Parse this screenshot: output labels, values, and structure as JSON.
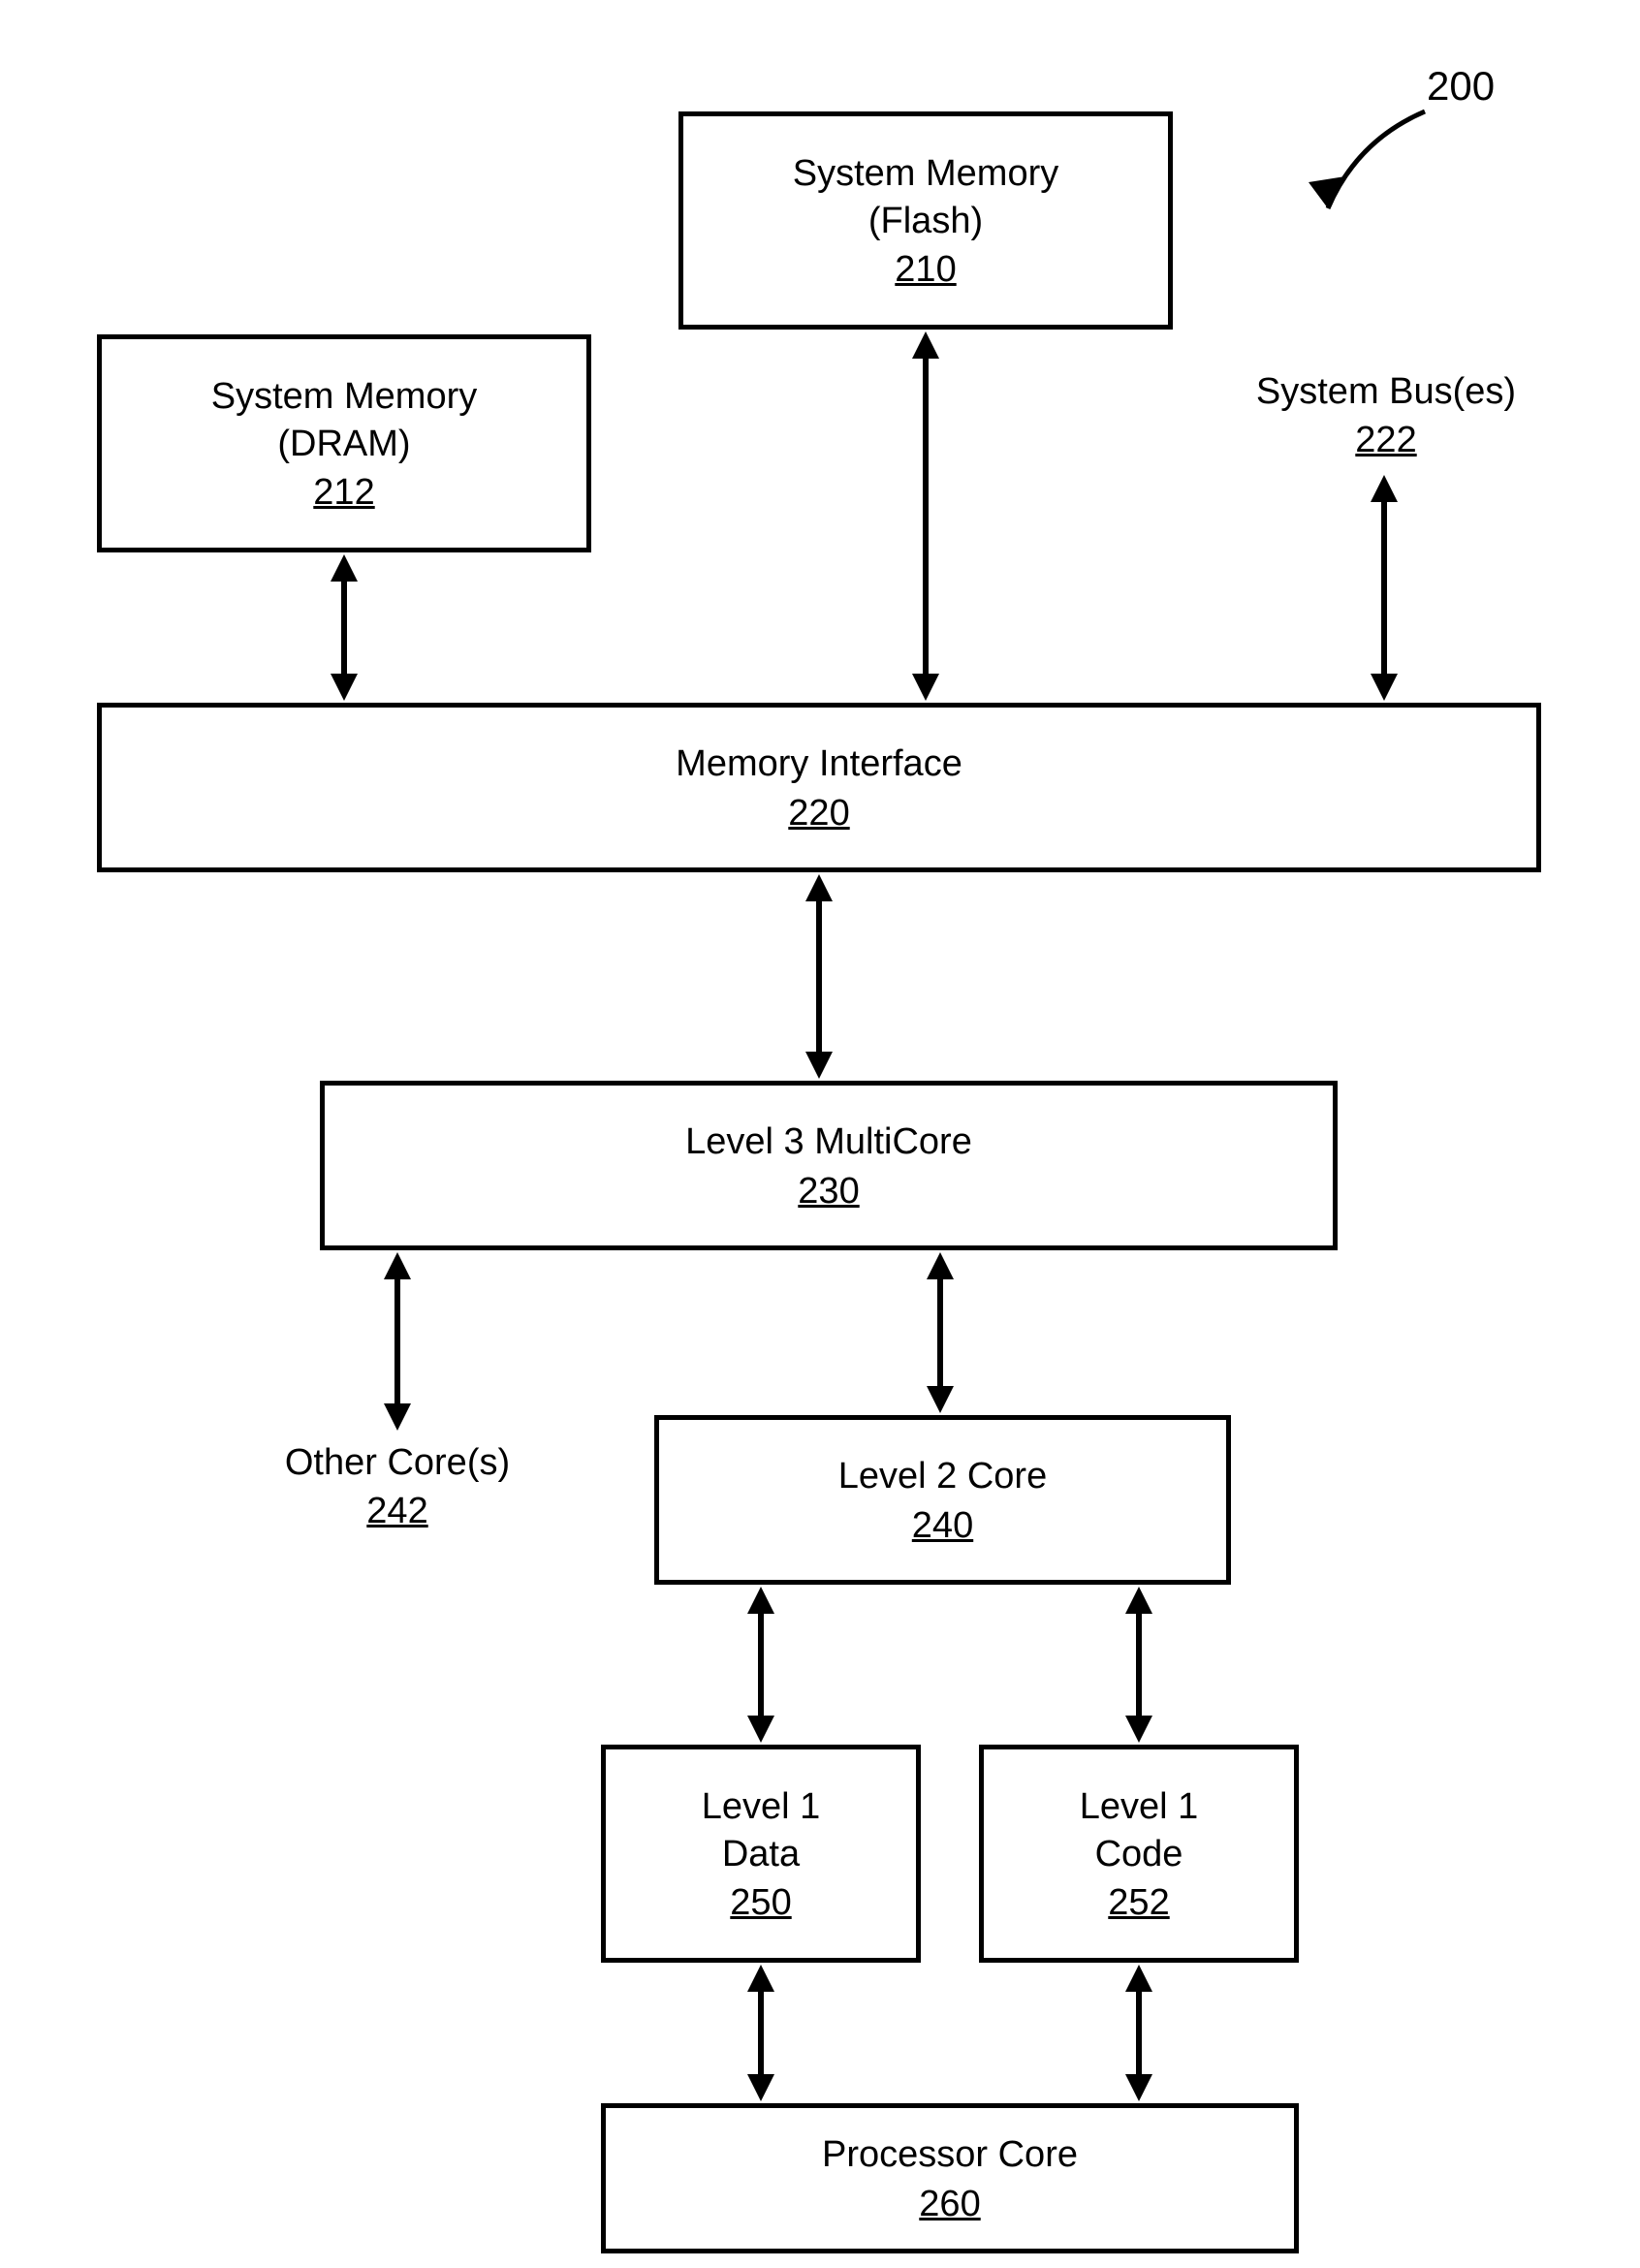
{
  "figLabel": "200",
  "boxes": {
    "sysMemFlash": {
      "title": "System Memory\n(Flash)",
      "ref": "210"
    },
    "sysMemDram": {
      "title": "System Memory\n(DRAM)",
      "ref": "212"
    },
    "memInterface": {
      "title": "Memory Interface",
      "ref": "220"
    },
    "l3Multicore": {
      "title": "Level 3 MultiCore",
      "ref": "230"
    },
    "l2Core": {
      "title": "Level 2 Core",
      "ref": "240"
    },
    "l1Data": {
      "title": "Level 1\nData",
      "ref": "250"
    },
    "l1Code": {
      "title": "Level 1\nCode",
      "ref": "252"
    },
    "procCore": {
      "title": "Processor Core",
      "ref": "260"
    }
  },
  "labels": {
    "sysBus": {
      "title": "System Bus(es)",
      "ref": "222"
    },
    "otherCores": {
      "title": "Other Core(s)",
      "ref": "242"
    }
  }
}
